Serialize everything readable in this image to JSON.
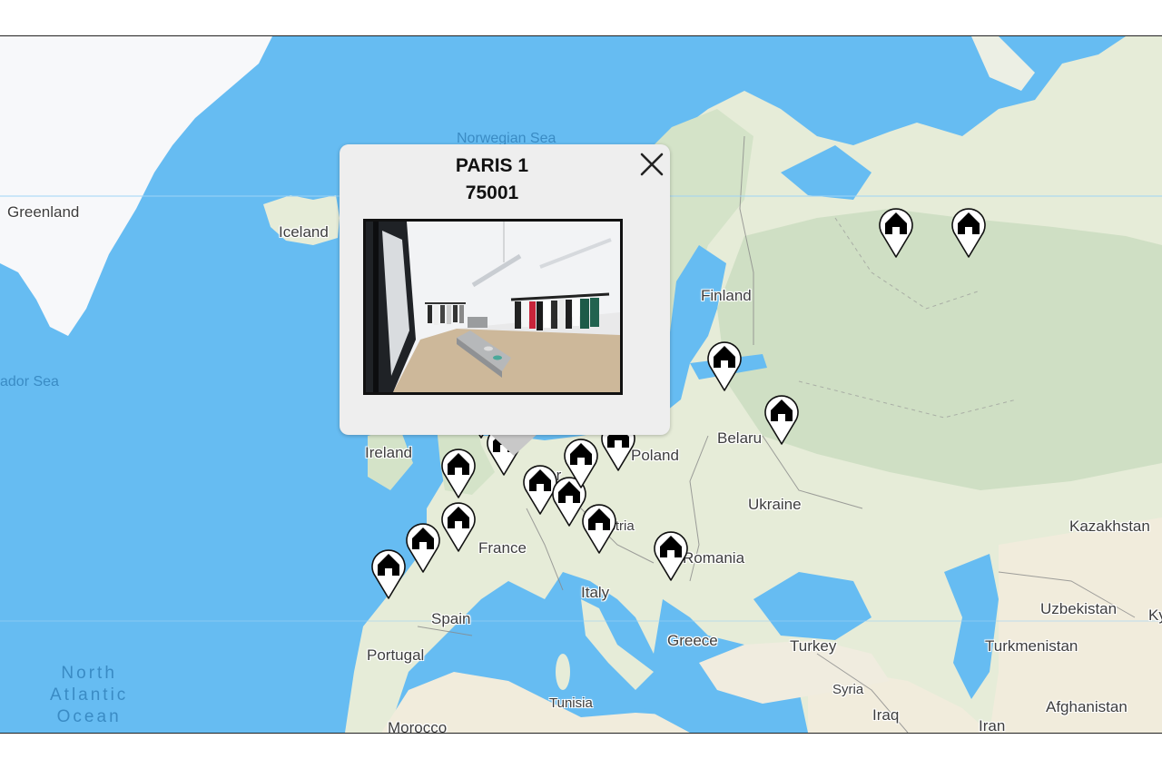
{
  "map": {
    "colors": {
      "water": "#66bcf2",
      "land": "#e6ecd8",
      "forest": "#c9dbbf",
      "ice": "#f7f8fa",
      "desert": "#f1ecdc",
      "border": "#777777"
    },
    "country_labels": [
      {
        "id": "greenland",
        "text": "Greenland"
      },
      {
        "id": "iceland",
        "text": "Iceland"
      },
      {
        "id": "finland",
        "text": "Finland"
      },
      {
        "id": "ireland",
        "text": "Ireland"
      },
      {
        "id": "poland",
        "text": "Poland"
      },
      {
        "id": "belarus",
        "text": "Belaru"
      },
      {
        "id": "ukraine",
        "text": "Ukraine"
      },
      {
        "id": "germany",
        "text": "Ger"
      },
      {
        "id": "austria",
        "text": "Austria"
      },
      {
        "id": "france",
        "text": "France"
      },
      {
        "id": "romania",
        "text": "Romania"
      },
      {
        "id": "italy",
        "text": "Italy"
      },
      {
        "id": "spain",
        "text": "Spain"
      },
      {
        "id": "portugal",
        "text": "Portugal"
      },
      {
        "id": "greece",
        "text": "Greece"
      },
      {
        "id": "turkey",
        "text": "Turkey"
      },
      {
        "id": "syria",
        "text": "Syria"
      },
      {
        "id": "iraq",
        "text": "Iraq"
      },
      {
        "id": "iran",
        "text": "Iran"
      },
      {
        "id": "tunisia",
        "text": "Tunisia"
      },
      {
        "id": "morocco",
        "text": "Morocco"
      },
      {
        "id": "kazakhstan",
        "text": "Kazakhstan"
      },
      {
        "id": "uzbekistan",
        "text": "Uzbekistan"
      },
      {
        "id": "turkmenistan",
        "text": "Turkmenistan"
      },
      {
        "id": "afghanistan",
        "text": "Afghanistan"
      },
      {
        "id": "kyrgyzstan",
        "text": "Ky"
      }
    ],
    "water_labels": [
      {
        "id": "norwegian-sea",
        "text": "Norwegian Sea"
      },
      {
        "id": "labrador-sea",
        "text": "ador Sea"
      }
    ],
    "ocean_label": [
      "North",
      "Atlantic",
      "Ocean"
    ],
    "marker_icon": "house-icon",
    "marker_count": 17
  },
  "popup": {
    "title": "PARIS 1",
    "postcode": "75001",
    "close_icon": "close-icon",
    "image_alt": "Store interior with clothing racks"
  }
}
